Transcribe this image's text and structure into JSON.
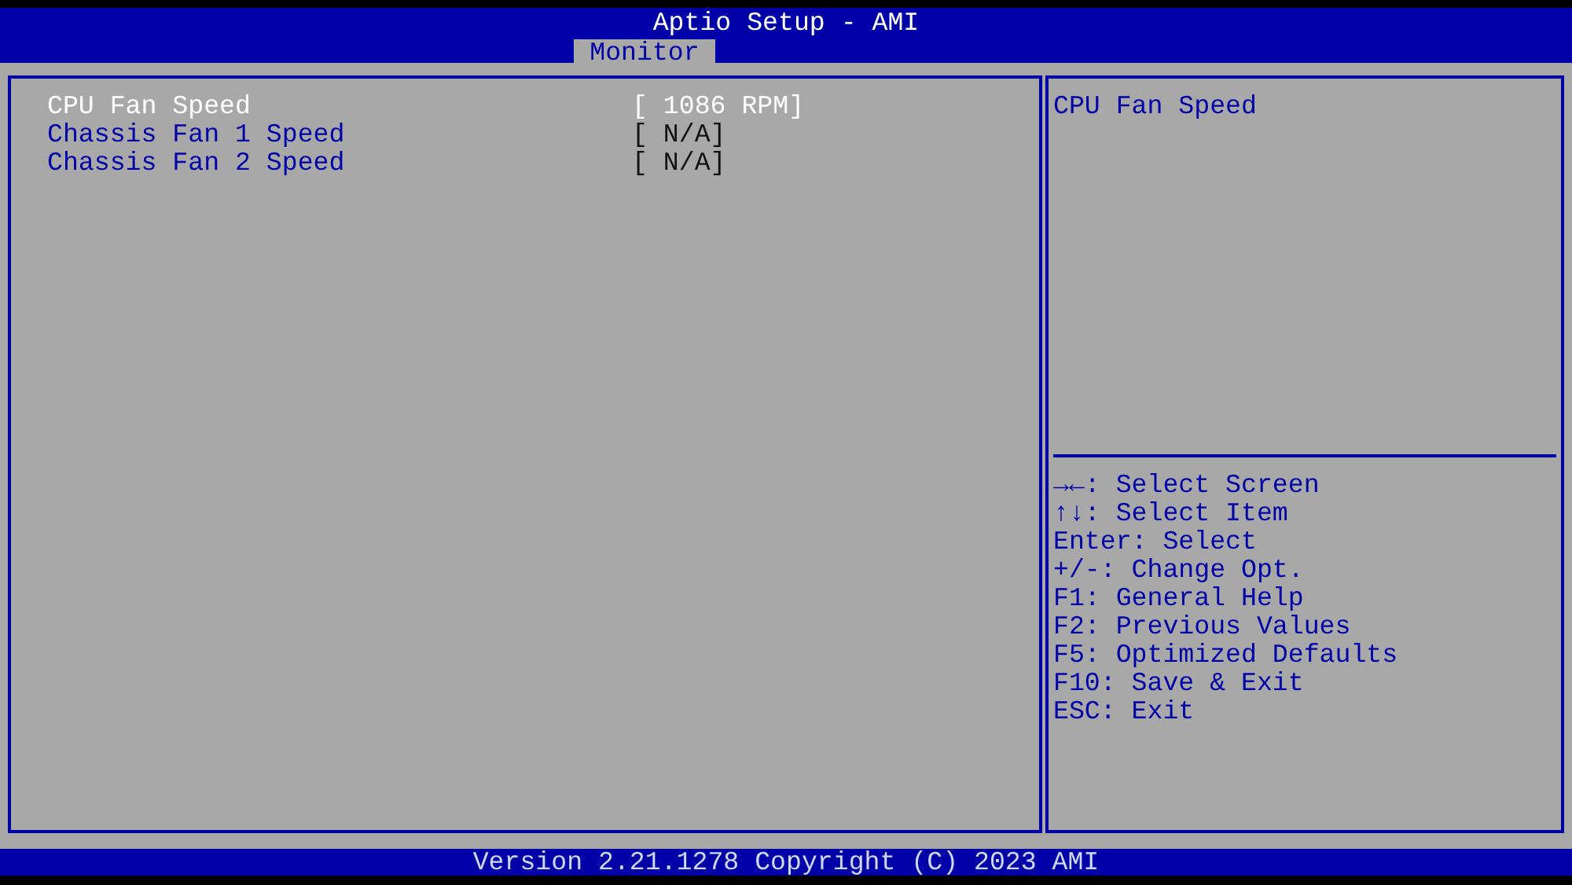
{
  "header": {
    "title": "Aptio Setup - AMI",
    "tabs": [
      {
        "label": "Monitor",
        "selected": true
      }
    ]
  },
  "items": [
    {
      "label": "CPU Fan Speed",
      "value": "[  1086 RPM]",
      "selected": true
    },
    {
      "label": "Chassis Fan 1 Speed",
      "value": "[  N/A]",
      "selected": false
    },
    {
      "label": "Chassis Fan 2 Speed",
      "value": "[  N/A]",
      "selected": false
    }
  ],
  "help": {
    "text": "CPU Fan Speed",
    "keys": [
      "→←: Select Screen",
      "↑↓: Select Item",
      "Enter: Select",
      "+/-: Change Opt.",
      "F1: General Help",
      "F2: Previous Values",
      "F5: Optimized Defaults",
      "F10: Save & Exit",
      "ESC: Exit"
    ]
  },
  "footer": {
    "text": "Version 2.21.1278 Copyright (C) 2023 AMI"
  }
}
